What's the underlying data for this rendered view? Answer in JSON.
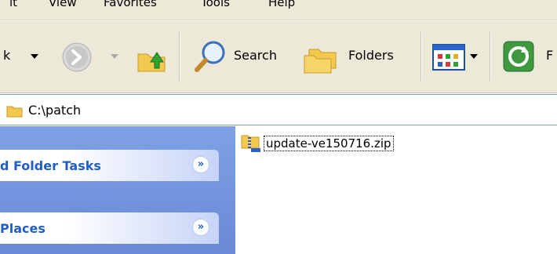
{
  "menubar": {
    "items": [
      {
        "label": "it"
      },
      {
        "label": "View"
      },
      {
        "label": "Favorites"
      },
      {
        "label": "Tools"
      },
      {
        "label": "Help"
      }
    ]
  },
  "toolbar": {
    "back_label_fragment": "k",
    "search_label": "Search",
    "folders_label": "Folders",
    "truncated_label": "F",
    "icons": [
      "back-arrow-icon",
      "forward-arrow-icon",
      "up-folder-icon",
      "search-magnifier-icon",
      "folders-icon",
      "views-icon",
      "sync-icon"
    ]
  },
  "address": {
    "path": "C:\\patch"
  },
  "taskpane": {
    "sections": [
      {
        "title": "d Folder Tasks"
      },
      {
        "title": "Places"
      }
    ]
  },
  "files": [
    {
      "name": "update-ve150716.zip",
      "icon": "zip-file-icon"
    }
  ],
  "colors": {
    "chrome": "#ece9d8",
    "taskpane_blue": "#7ea2e4",
    "task_title": "#215dc6"
  }
}
